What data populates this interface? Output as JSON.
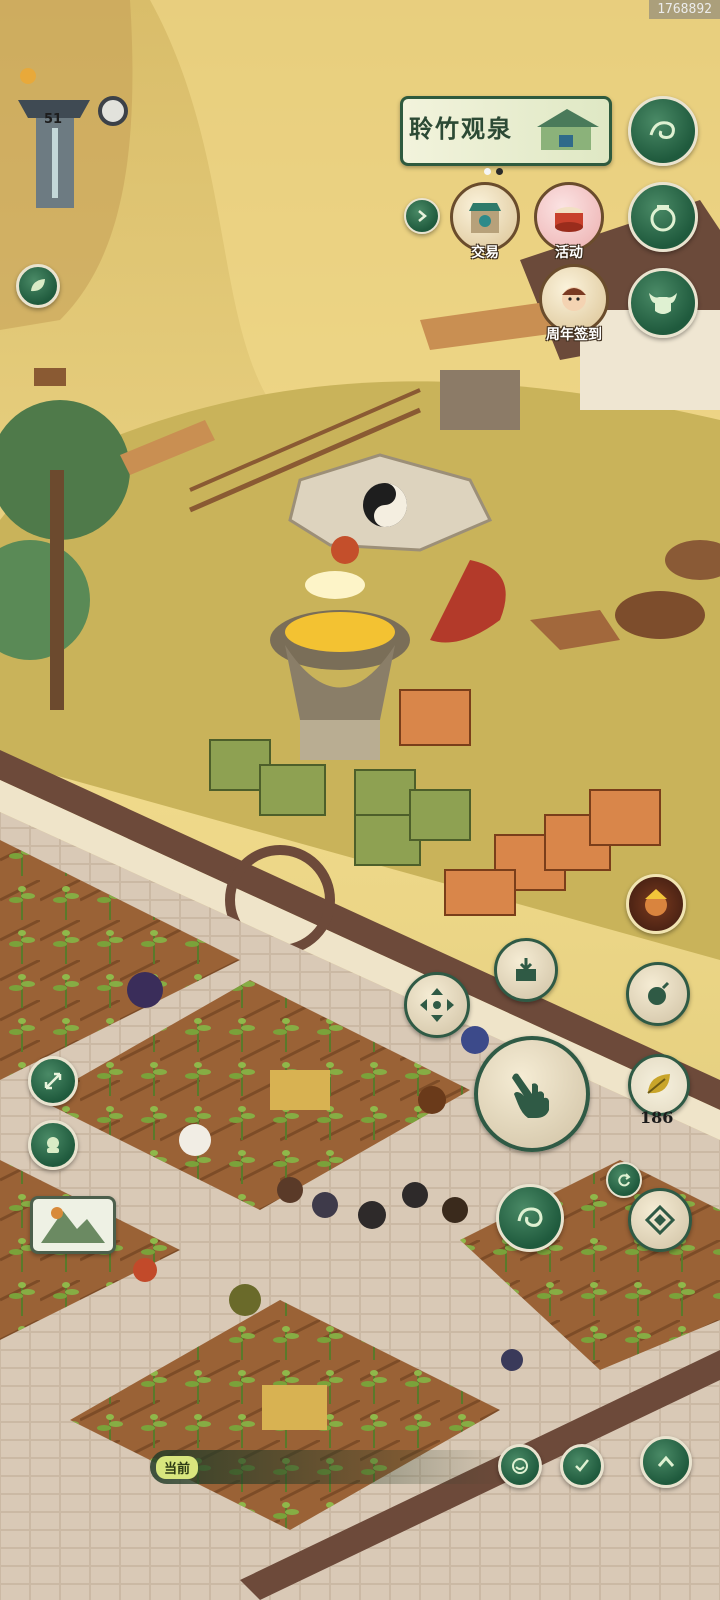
{
  "uid": "1768892",
  "player": {
    "level": "51"
  },
  "banner": {
    "title": "聆竹观泉"
  },
  "carousel": {
    "page_count": 2,
    "active_index": 1
  },
  "features": [
    {
      "label": "交易",
      "icon": "trade-shop-icon"
    },
    {
      "label": "活动",
      "icon": "event-drum-icon"
    },
    {
      "label": "周年签到",
      "icon": "anniversary-checkin-icon"
    }
  ],
  "right_menu": [
    {
      "icon": "swirl-wave-icon"
    },
    {
      "icon": "pot-bag-icon"
    },
    {
      "icon": "ox-mask-icon"
    }
  ],
  "resources": {
    "leaf_count": "186"
  },
  "status": {
    "current_label": "当前"
  },
  "colors": {
    "accent_green": "#1f5a3d",
    "frame_cream": "#e9e3cf",
    "ground_yellow": "#e6cf7a"
  }
}
